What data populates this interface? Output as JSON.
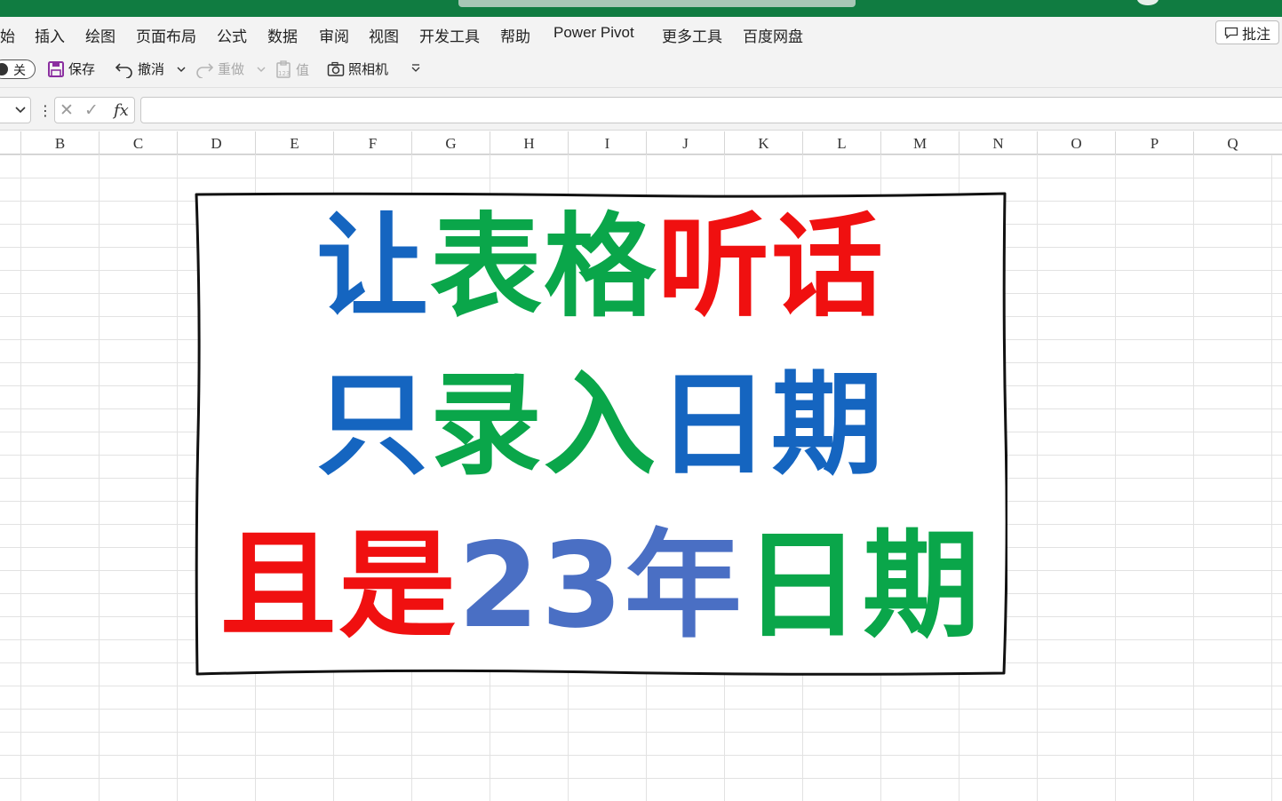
{
  "menu": {
    "items": [
      "始",
      "插入",
      "绘图",
      "页面布局",
      "公式",
      "数据",
      "审阅",
      "视图",
      "开发工具",
      "帮助",
      "Power Pivot",
      "更多工具",
      "百度网盘"
    ],
    "comment_button": "批注"
  },
  "quick_access": {
    "autosave_state": "关",
    "save": "保存",
    "undo": "撤消",
    "redo": "重做",
    "values": "值",
    "camera": "照相机"
  },
  "formula_bar": {
    "fx": "fx",
    "value": ""
  },
  "columns": [
    "B",
    "C",
    "D",
    "E",
    "F",
    "G",
    "H",
    "I",
    "J",
    "K",
    "L",
    "M",
    "N",
    "O",
    "P",
    "Q"
  ],
  "card": {
    "line1": [
      {
        "text": "让",
        "color": "#1565c0"
      },
      {
        "text": "表格",
        "color": "#0aa64a"
      },
      {
        "text": "听话",
        "color": "#f01010"
      }
    ],
    "line2": [
      {
        "text": "只",
        "color": "#1565c0"
      },
      {
        "text": "录入",
        "color": "#0aa64a"
      },
      {
        "text": "日期",
        "color": "#1565c0"
      }
    ],
    "line3": [
      {
        "text": "且是",
        "color": "#f01010"
      },
      {
        "text": "23年",
        "color": "#4a6fc4"
      },
      {
        "text": "日期",
        "color": "#0aa64a"
      }
    ]
  },
  "colors": {
    "title_bar": "#107c41",
    "ribbon_bg": "#f3f3f3",
    "gridline": "#e2e2e2"
  }
}
